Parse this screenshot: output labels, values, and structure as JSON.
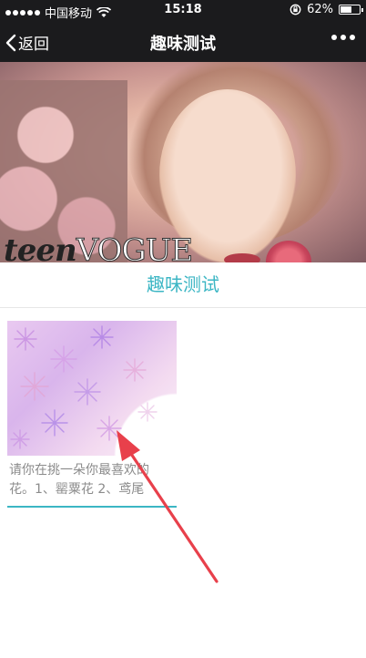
{
  "status_bar": {
    "carrier": "中国移动",
    "time": "15:18",
    "battery": "62%",
    "battery_level": 0.62
  },
  "nav": {
    "back_label": "返回",
    "title": "趣味测试",
    "back_icon": "chevron-left-icon",
    "more_icon": "more-dots-icon"
  },
  "banner": {
    "word_part_a": "teen",
    "word_part_b": "VOGUE"
  },
  "section": {
    "title": "趣味测试"
  },
  "article": {
    "text_line1": "请你在挑一朵你最喜欢的",
    "text_line2": "花。1、罂粟花 2、鸢尾"
  },
  "colors": {
    "accent": "#3cb6c4",
    "bar": "#1b1b1d",
    "arrow": "#e8404b"
  }
}
